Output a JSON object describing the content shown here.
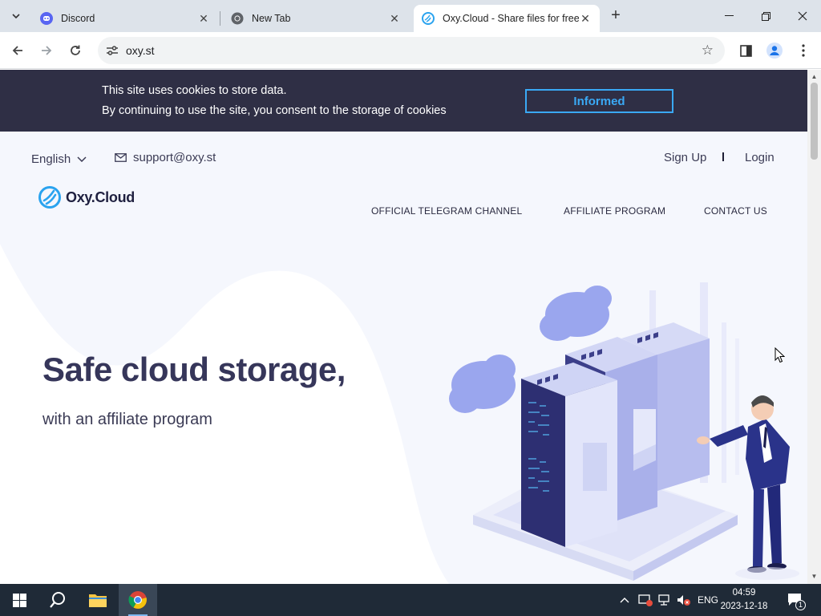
{
  "browser": {
    "tabs": [
      {
        "title": "Discord",
        "icon": "discord-icon",
        "active": false
      },
      {
        "title": "New Tab",
        "icon": "chrome-icon",
        "active": false
      },
      {
        "title": "Oxy.Cloud - Share files for free",
        "icon": "oxy-cloud-icon",
        "active": true
      }
    ],
    "url": "oxy.st",
    "accent_color": "#3aa9f5"
  },
  "cookie_banner": {
    "line1": "This site uses cookies to store data.",
    "line2": "By continuing to use the site, you consent to the storage of cookies",
    "button_label": "Informed"
  },
  "header": {
    "language": "English",
    "support_email": "support@oxy.st",
    "signup_label": "Sign Up",
    "login_label": "Login",
    "logo_text": "Oxy.Cloud",
    "nav": [
      "OFFICIAL TELEGRAM CHANNEL",
      "AFFILIATE PROGRAM",
      "CONTACT US"
    ]
  },
  "hero": {
    "title": "Safe cloud storage,",
    "subtitle": "with an affiliate program"
  },
  "taskbar": {
    "language": "ENG",
    "time": "04:59",
    "date": "2023-12-18",
    "notification_count": "1"
  }
}
